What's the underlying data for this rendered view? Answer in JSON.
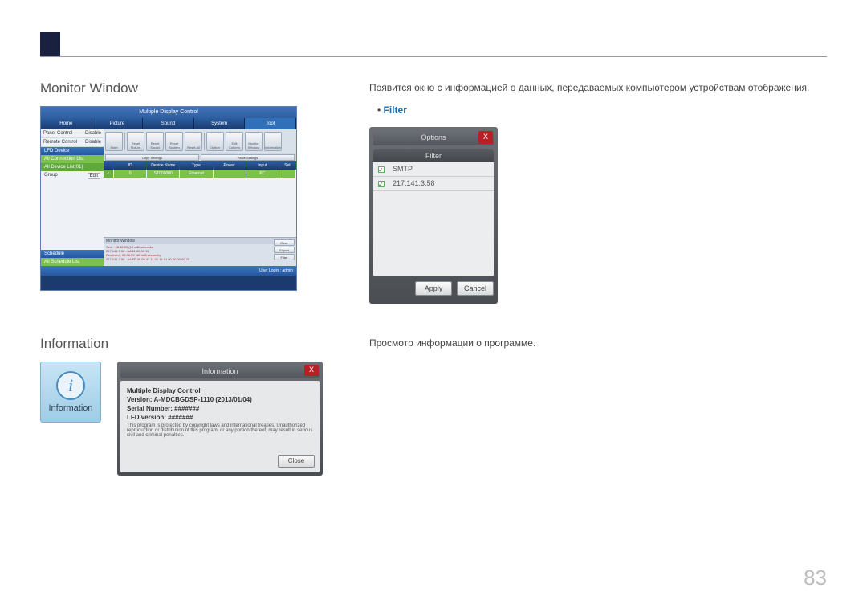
{
  "page_number": "83",
  "section1": {
    "title": "Monitor Window",
    "desc": "Появится окно с информацией о данных, передаваемых компьютером устройствам отображения.",
    "bullet_label": "Filter"
  },
  "app": {
    "title": "Multiple Display Control",
    "tabs": [
      "Home",
      "Picture",
      "Sound",
      "System",
      "Tool"
    ],
    "active_tab": 4,
    "side_panel_control": "Panel Control",
    "side_remote_control": "Remote Control",
    "side_disable": "Disable",
    "side_lfd_header": "LFD Device",
    "side_all_conn": "All Connection List",
    "side_all_device": "All Device List(01)",
    "side_group": "Group",
    "side_edit": "Edit",
    "side_schedule": "Schedule",
    "side_all_schedule": "All Schedule List",
    "toolbar": [
      "More",
      "Reset Picture",
      "Reset Sound",
      "Reset System",
      "Reset All",
      "Option",
      "Edit Column",
      "Monitor Window",
      "Information"
    ],
    "toolbar_groups": [
      "Copy Settings",
      "Paste Settings"
    ],
    "grid_headers": [
      "ID",
      "Device Name",
      "Type",
      "Power",
      "Input",
      "Set"
    ],
    "grid_row": [
      "0",
      "ST000000",
      "Ethernet",
      "",
      "PC",
      ""
    ],
    "monitor_header": "Monitor Window",
    "monitor_sent": "Sent : 05:36:59 (14 milli seconds)",
    "monitor_addr": "217.141.3.58 : AA 11 00 00 11",
    "monitor_recv": "Received : 05:36:59 (46 milli seconds)",
    "monitor_recv2": "217.141.3.58 : AA FF 00 09 41 11 01 14 01 00 00 00 00 70",
    "mon_btn_clear": "Clear",
    "mon_btn_export": "Export",
    "mon_btn_filter": "Filter",
    "status": "User Login : admin"
  },
  "options_dialog": {
    "title": "Options",
    "filter_header": "Filter",
    "row1": "SMTP",
    "row2": "217.141.3.58",
    "apply": "Apply",
    "cancel": "Cancel",
    "close_x": "X"
  },
  "section2": {
    "title": "Information",
    "desc": "Просмотр информации о программе."
  },
  "info_icon_label": "Information",
  "info_dialog": {
    "title": "Information",
    "close_x": "X",
    "product": "Multiple Display Control",
    "version_label": "Version: A-MDCBGDSP-1110 (2013/01/04)",
    "serial_label": "Serial Number: #######",
    "lfd_label": "LFD version: #######",
    "legal": "This program is protected by copyright laws and international treaties. Unauthorized reproduction or distribution of this program, or any portion thereof, may result in serious civil and criminal penalties.",
    "close": "Close"
  }
}
